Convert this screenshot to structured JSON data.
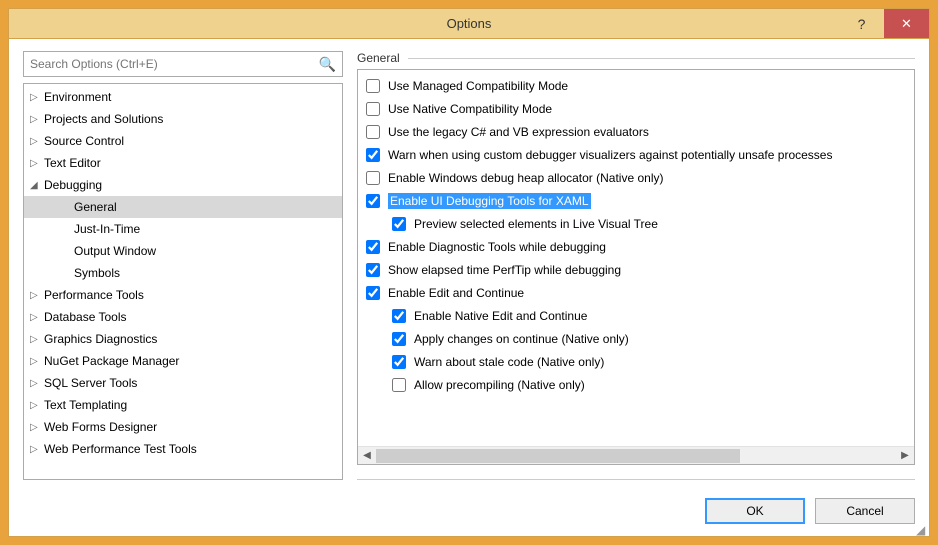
{
  "window": {
    "title": "Options"
  },
  "search": {
    "placeholder": "Search Options (Ctrl+E)"
  },
  "tree": {
    "items": [
      {
        "label": "Environment",
        "glyph": "▷",
        "selected": false,
        "child": false
      },
      {
        "label": "Projects and Solutions",
        "glyph": "▷",
        "selected": false,
        "child": false
      },
      {
        "label": "Source Control",
        "glyph": "▷",
        "selected": false,
        "child": false
      },
      {
        "label": "Text Editor",
        "glyph": "▷",
        "selected": false,
        "child": false
      },
      {
        "label": "Debugging",
        "glyph": "◢",
        "selected": false,
        "child": false
      },
      {
        "label": "General",
        "glyph": "",
        "selected": true,
        "child": true
      },
      {
        "label": "Just-In-Time",
        "glyph": "",
        "selected": false,
        "child": true
      },
      {
        "label": "Output Window",
        "glyph": "",
        "selected": false,
        "child": true
      },
      {
        "label": "Symbols",
        "glyph": "",
        "selected": false,
        "child": true
      },
      {
        "label": "Performance Tools",
        "glyph": "▷",
        "selected": false,
        "child": false
      },
      {
        "label": "Database Tools",
        "glyph": "▷",
        "selected": false,
        "child": false
      },
      {
        "label": "Graphics Diagnostics",
        "glyph": "▷",
        "selected": false,
        "child": false
      },
      {
        "label": "NuGet Package Manager",
        "glyph": "▷",
        "selected": false,
        "child": false
      },
      {
        "label": "SQL Server Tools",
        "glyph": "▷",
        "selected": false,
        "child": false
      },
      {
        "label": "Text Templating",
        "glyph": "▷",
        "selected": false,
        "child": false
      },
      {
        "label": "Web Forms Designer",
        "glyph": "▷",
        "selected": false,
        "child": false
      },
      {
        "label": "Web Performance Test Tools",
        "glyph": "▷",
        "selected": false,
        "child": false
      }
    ]
  },
  "section": {
    "header": "General"
  },
  "options": [
    {
      "label": "Use Managed Compatibility Mode",
      "checked": false,
      "indent": false,
      "highlight": false
    },
    {
      "label": "Use Native Compatibility Mode",
      "checked": false,
      "indent": false,
      "highlight": false
    },
    {
      "label": "Use the legacy C# and VB expression evaluators",
      "checked": false,
      "indent": false,
      "highlight": false
    },
    {
      "label": "Warn when using custom debugger visualizers against potentially unsafe processes",
      "checked": true,
      "indent": false,
      "highlight": false
    },
    {
      "label": "Enable Windows debug heap allocator (Native only)",
      "checked": false,
      "indent": false,
      "highlight": false
    },
    {
      "label": "Enable UI Debugging Tools for XAML",
      "checked": true,
      "indent": false,
      "highlight": true
    },
    {
      "label": "Preview selected elements in Live Visual Tree",
      "checked": true,
      "indent": true,
      "highlight": false
    },
    {
      "label": "Enable Diagnostic Tools while debugging",
      "checked": true,
      "indent": false,
      "highlight": false
    },
    {
      "label": "Show elapsed time PerfTip while debugging",
      "checked": true,
      "indent": false,
      "highlight": false
    },
    {
      "label": "Enable Edit and Continue",
      "checked": true,
      "indent": false,
      "highlight": false
    },
    {
      "label": "Enable Native Edit and Continue",
      "checked": true,
      "indent": true,
      "highlight": false
    },
    {
      "label": "Apply changes on continue (Native only)",
      "checked": true,
      "indent": true,
      "highlight": false
    },
    {
      "label": "Warn about stale code (Native only)",
      "checked": true,
      "indent": true,
      "highlight": false
    },
    {
      "label": "Allow precompiling (Native only)",
      "checked": false,
      "indent": true,
      "highlight": false
    }
  ],
  "buttons": {
    "ok": "OK",
    "cancel": "Cancel"
  }
}
